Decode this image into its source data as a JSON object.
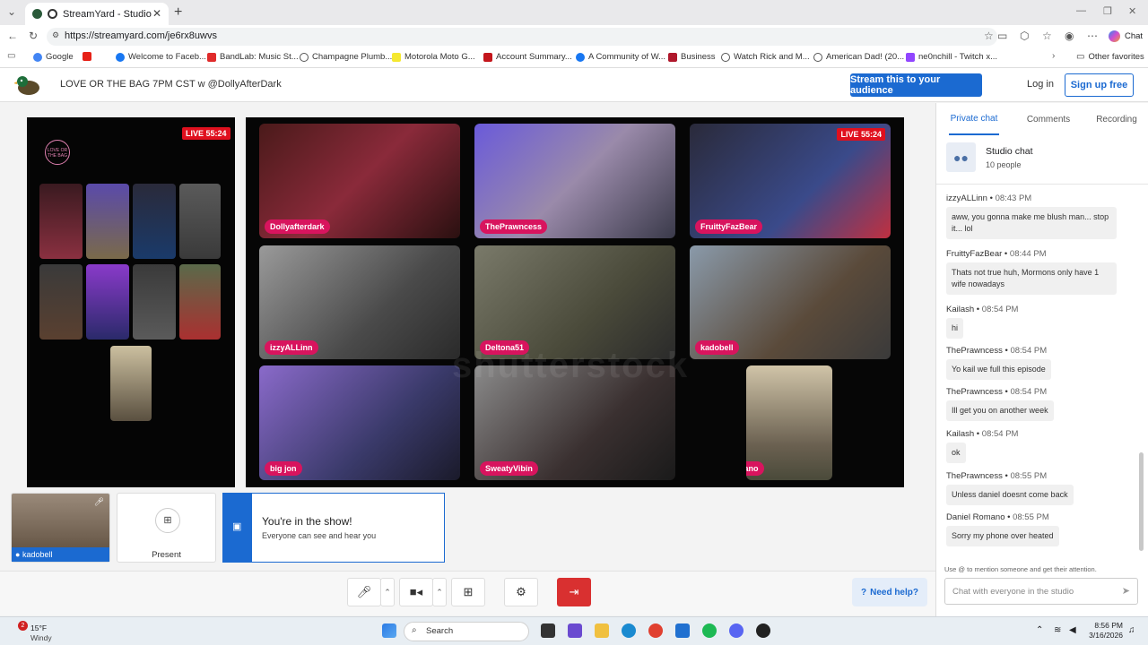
{
  "browser": {
    "tab_title": "StreamYard - Studio",
    "url": "https://streamyard.com/je6rx8uwvs",
    "chat_label": "Chat",
    "bookmarks": [
      "Google",
      "",
      "Welcome to Faceb...",
      "BandLab: Music St...",
      "Champagne Plumb...",
      "Motorola Moto G...",
      "Account Summary...",
      "A Community of W...",
      "Business",
      "Watch Rick and M...",
      "American Dad! (20...",
      "ne0nchill - Twitch x..."
    ],
    "other_favorites": "Other favorites"
  },
  "header": {
    "show_title": "LOVE OR THE BAG 7PM CST w @DollyAfterDark",
    "stream_button": "Stream this to your audience",
    "login": "Log in",
    "signup": "Sign up free"
  },
  "preview": {
    "live": "LIVE 55:24",
    "logo_text": "LOVE OR THE BAG"
  },
  "stage": {
    "live": "LIVE 55:24",
    "watermark": "shutterstock",
    "participants": [
      "Dollyafterdark",
      "ThePrawncess",
      "FruittyFazBear",
      "izzyALLinn",
      "Deltona51",
      "kadobell",
      "big jon",
      "SweatyVibin",
      "Daniel Romano"
    ]
  },
  "bottom": {
    "self_name": "kadobell",
    "present_label": "Present",
    "show_title": "You're in the show!",
    "show_sub": "Everyone can see and hear you"
  },
  "toolbar": {
    "help": "Need help?"
  },
  "sidebar": {
    "tabs": [
      "Private chat",
      "Comments",
      "Recording"
    ],
    "studio_chat": "Studio chat",
    "people": "10 people",
    "messages": [
      {
        "user": "izzyALLinn",
        "time": "08:43 PM",
        "text": "aww, you gonna make me blush man... stop it... lol"
      },
      {
        "user": "FruittyFazBear",
        "time": "08:44 PM",
        "text": "Thats not true huh, Mormons only have 1 wife nowadays"
      },
      {
        "user": "Kailash",
        "time": "08:54 PM",
        "text": "hi"
      },
      {
        "user": "ThePrawncess",
        "time": "08:54 PM",
        "text": "Yo kail we full this episode"
      },
      {
        "user": "ThePrawncess",
        "time": "08:54 PM",
        "text": "Ill get you on another week"
      },
      {
        "user": "Kailash",
        "time": "08:54 PM",
        "text": "ok"
      },
      {
        "user": "ThePrawncess",
        "time": "08:55 PM",
        "text": "Unless daniel doesnt come back"
      },
      {
        "user": "Daniel Romano",
        "time": "08:55 PM",
        "text": "Sorry my phone over heated"
      }
    ],
    "hint": "Use @ to mention someone and get their attention.",
    "input_placeholder": "Chat with everyone in the studio"
  },
  "taskbar": {
    "weather_temp": "15°F",
    "weather_desc": "Windy",
    "weather_badge": "2",
    "search": "Search",
    "time": "8:56 PM",
    "date": "3/16/2026"
  }
}
